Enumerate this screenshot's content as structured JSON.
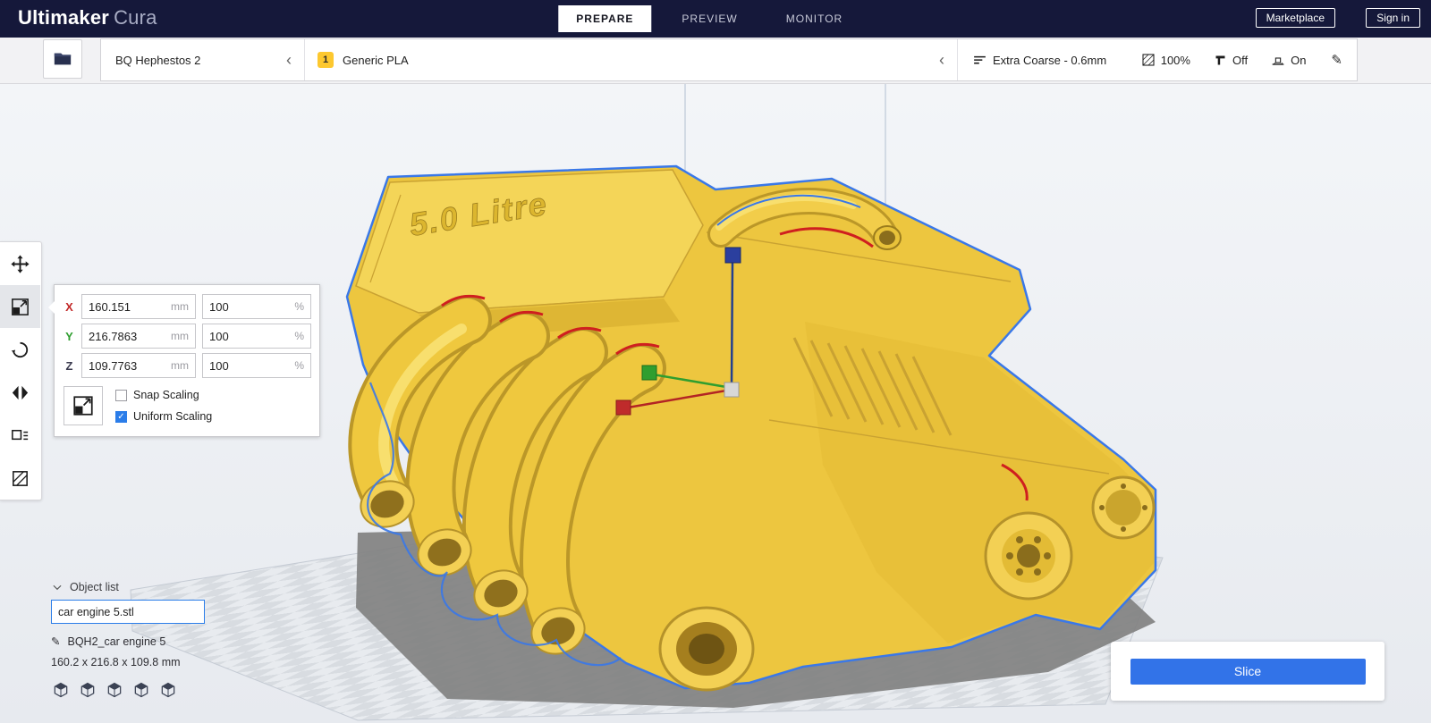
{
  "colors": {
    "topbar_bg": "#15183a",
    "accent_blue": "#2b7de9",
    "slice_button_blue": "#3273e8",
    "model_yellow": "#edc63f",
    "selection_outline_blue": "#3a78e8",
    "axis_x_red": "#c22828",
    "axis_y_green": "#2f9e2f",
    "axis_z_blue": "#2b3f9e",
    "extruder_badge_yellow": "#fdc82f"
  },
  "topbar": {
    "brand_primary": "Ultimaker",
    "brand_secondary": "Cura",
    "tabs": [
      {
        "label": "PREPARE",
        "active": true
      },
      {
        "label": "PREVIEW",
        "active": false
      },
      {
        "label": "MONITOR",
        "active": false
      }
    ],
    "marketplace_button": "Marketplace",
    "signin_button": "Sign in"
  },
  "toolbar": {
    "printer_name": "BQ Hephestos 2",
    "collapse_chevron": "‹",
    "extruder_badge": "1",
    "material_name": "Generic PLA",
    "profile_name": "Extra Coarse - 0.6mm",
    "infill_value": "100%",
    "support_value": "Off",
    "adhesion_value": "On",
    "edit_icon_glyph": "✎"
  },
  "scale_panel": {
    "rows": [
      {
        "axis": "X",
        "mm": "160.151",
        "percent": "100"
      },
      {
        "axis": "Y",
        "mm": "216.7863",
        "percent": "100"
      },
      {
        "axis": "Z",
        "mm": "109.7763",
        "percent": "100"
      }
    ],
    "mm_unit": "mm",
    "percent_unit": "%",
    "snap_label": "Snap Scaling",
    "uniform_label": "Uniform Scaling",
    "check_glyph": "✓",
    "snap_checked": false,
    "uniform_checked": true
  },
  "viewport": {
    "model_label": "5.0 Litre"
  },
  "object_list": {
    "header": "Object list",
    "selected_file": "car engine 5.stl",
    "job_name": "BQH2_car engine 5",
    "dimensions": "160.2 x 216.8 x 109.8 mm",
    "edit_icon_glyph": "✎"
  },
  "slice_panel": {
    "slice_button": "Slice"
  }
}
